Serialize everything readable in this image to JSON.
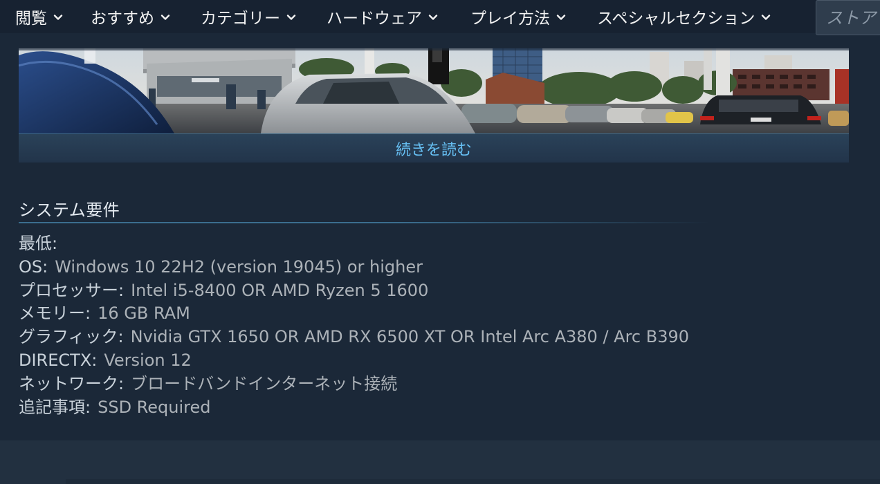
{
  "nav": {
    "items": [
      {
        "label": "閲覧"
      },
      {
        "label": "おすすめ"
      },
      {
        "label": "カテゴリー"
      },
      {
        "label": "ハードウェア"
      },
      {
        "label": "プレイ方法"
      },
      {
        "label": "スペシャルセクション"
      }
    ],
    "search_placeholder": "ストア",
    "chevron_icon": "chevron-down-icon"
  },
  "banner": {
    "read_more": "続きを読む"
  },
  "sysreq": {
    "heading": "システム要件",
    "min_label": "最低:",
    "items": [
      {
        "label": "OS:",
        "value": "Windows 10 22H2 (version 19045) or higher"
      },
      {
        "label": "プロセッサー:",
        "value": "Intel i5-8400 OR AMD Ryzen 5 1600"
      },
      {
        "label": "メモリー:",
        "value": "16 GB RAM"
      },
      {
        "label": "グラフィック:",
        "value": "Nvidia GTX 1650 OR AMD RX 6500 XT OR Intel Arc A380 / Arc B390"
      },
      {
        "label": "DIRECTX:",
        "value": "Version 12"
      },
      {
        "label": "ネットワーク:",
        "value": "ブロードバンドインターネット接続"
      },
      {
        "label": "追記事項:",
        "value": "SSD Required"
      }
    ]
  },
  "colors": {
    "background": "#1b2838",
    "nav_background": "#172231",
    "link": "#67c1f5",
    "rule": "#3b6e8f"
  }
}
